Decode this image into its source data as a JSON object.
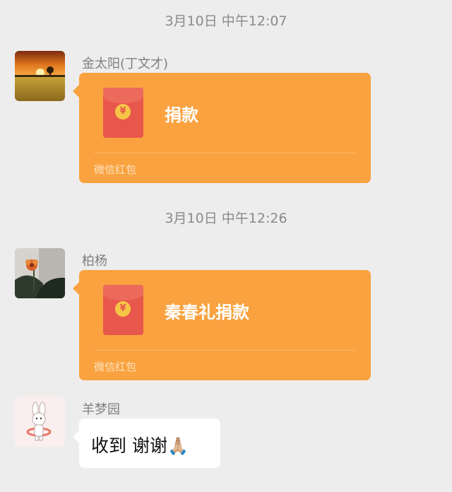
{
  "messages": [
    {
      "timestamp": "3月10日 中午12:07",
      "sender": "金太阳(丁文才)",
      "avatar": "sunset-field-avatar",
      "red_packet": {
        "title": "捐款",
        "footer": "微信红包",
        "coin_symbol": "¥"
      }
    },
    {
      "timestamp": "3月10日 中午12:26",
      "sender": "柏杨",
      "avatar": "flower-avatar",
      "red_packet": {
        "title": "秦春礼捐款",
        "footer": "微信红包",
        "coin_symbol": "¥"
      }
    },
    {
      "sender": "羊梦园",
      "avatar": "bunny-cartoon-avatar",
      "text": "收到 谢谢",
      "emoji": "🙏🏼"
    }
  ],
  "colors": {
    "background": "#ededed",
    "red_packet": "#f9a23f",
    "envelope": "#e8574b",
    "coin": "#f6c546",
    "bubble": "#ffffff"
  }
}
